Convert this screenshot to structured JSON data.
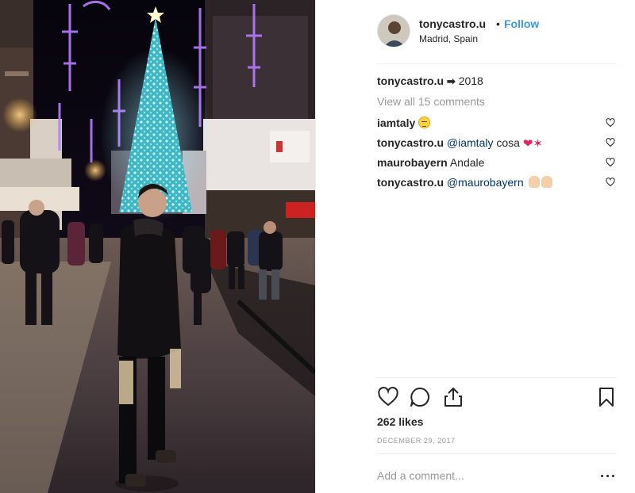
{
  "post": {
    "header": {
      "username": "tonycastro.u",
      "dot": "•",
      "follow_label": "Follow",
      "location": "Madrid, Spain"
    },
    "caption": {
      "username": "tonycastro.u",
      "emoji": "soon-arrow-emoji",
      "text": "2018"
    },
    "view_all_comments": "View all 15 comments",
    "comments": [
      {
        "username": "iamtaly",
        "mention": "",
        "text": "",
        "emoji": "smiling-face-emoji"
      },
      {
        "username": "tonycastro.u",
        "mention": "@iamtaly",
        "text": "cosa",
        "emoji": "red-heart-and-lobster-emoji"
      },
      {
        "username": "maurobayern",
        "mention": "",
        "text": "Andale",
        "emoji": ""
      },
      {
        "username": "tonycastro.u",
        "mention": "@maurobayern",
        "text": "",
        "emoji": "clapping-hands-emoji"
      }
    ],
    "likes": "262 likes",
    "date": "DECEMBER 29, 2017",
    "add_comment_placeholder": "Add a comment...",
    "colors": {
      "follow_blue": "#3897f0",
      "mention_blue": "#003569",
      "muted_gray": "#999999",
      "text_dark": "#262626",
      "divider": "#efefef",
      "heart_red": "#e0245e"
    },
    "icons": {
      "like": "heart-icon",
      "comment": "speech-bubble-icon",
      "share": "share-icon",
      "save": "bookmark-icon",
      "more": "ellipsis-icon"
    }
  }
}
